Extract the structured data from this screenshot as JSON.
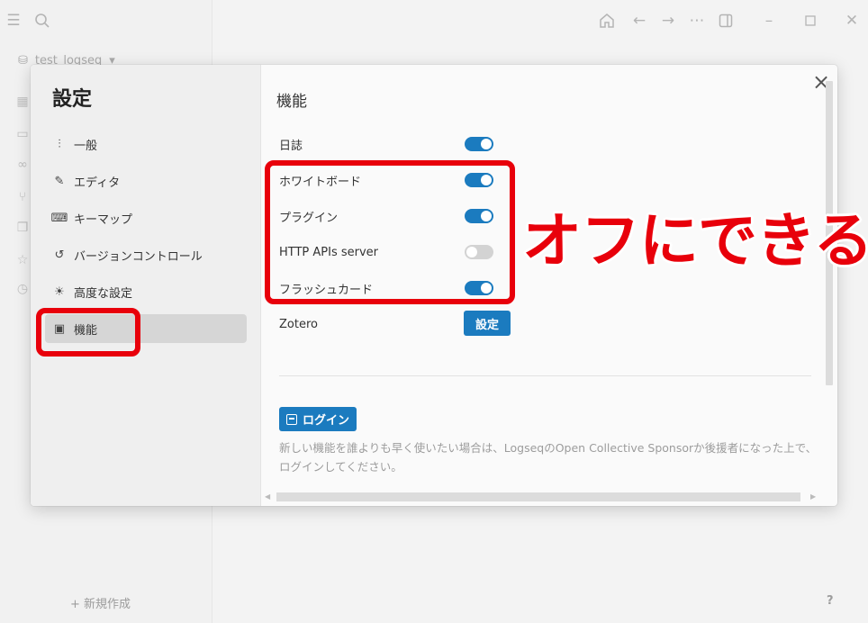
{
  "app": {
    "graph_name": "test_logseq",
    "new_page_label": "+ 新規作成",
    "help_label": "?"
  },
  "topbar": {
    "icons": [
      "menu-icon",
      "search-icon",
      "home-icon",
      "back-arrow-icon",
      "forward-arrow-icon",
      "more-icon",
      "sidebar-toggle-icon",
      "minimize-icon",
      "maximize-icon",
      "close-icon"
    ]
  },
  "settings": {
    "title": "設定",
    "menu": [
      {
        "label": "一般",
        "icon": "sliders-icon"
      },
      {
        "label": "エディタ",
        "icon": "editor-icon"
      },
      {
        "label": "キーマップ",
        "icon": "keyboard-icon"
      },
      {
        "label": "バージョンコントロール",
        "icon": "history-icon"
      },
      {
        "label": "高度な設定",
        "icon": "lightbulb-icon"
      },
      {
        "label": "機能",
        "icon": "features-icon",
        "active": true
      }
    ],
    "section_title": "機能",
    "toggles": [
      {
        "label": "日誌",
        "on": true
      },
      {
        "label": "ホワイトボード",
        "on": true
      },
      {
        "label": "プラグイン",
        "on": true
      },
      {
        "label": "HTTP APIs server",
        "on": false
      },
      {
        "label": "フラッシュカード",
        "on": true
      }
    ],
    "zotero": {
      "label": "Zotero",
      "button": "設定"
    },
    "login_button": "ログイン",
    "sponsor_text": "新しい機能を誰よりも早く使いたい場合は、LogseqのOpen Collective Sponsorか後援者になった上で、ログインしてください。"
  },
  "annotation": {
    "text": "オフにできる",
    "color": "#e8000b"
  },
  "colors": {
    "accent": "#1b7bbf",
    "toggle_off": "#d3d3d3",
    "highlight": "#e8000b"
  }
}
